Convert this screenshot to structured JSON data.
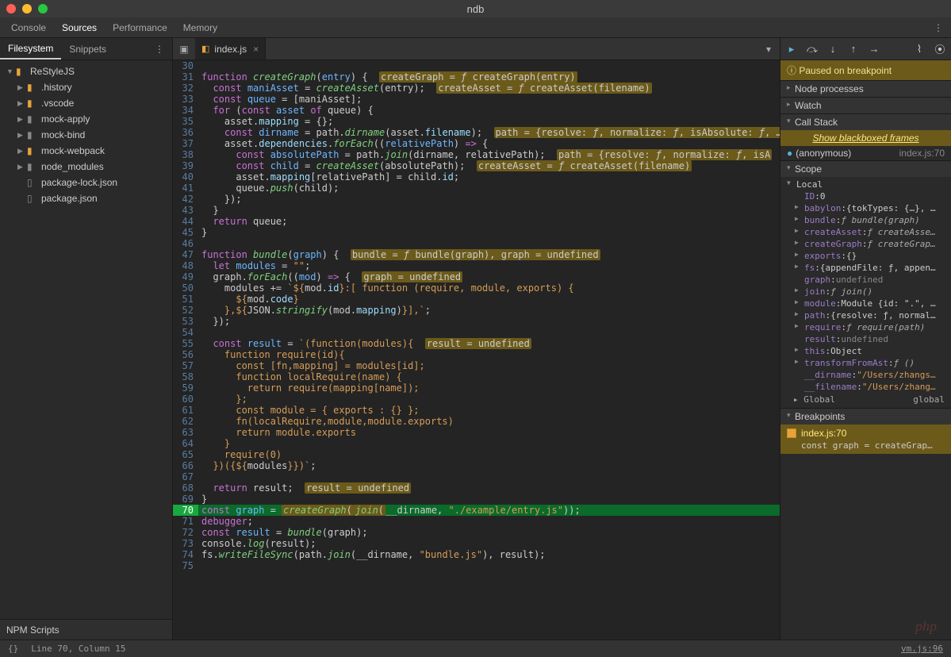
{
  "window": {
    "title": "ndb"
  },
  "top_tabs": [
    "Console",
    "Sources",
    "Performance",
    "Memory"
  ],
  "top_tabs_active": 1,
  "left": {
    "subtabs": [
      "Filesystem",
      "Snippets"
    ],
    "subtabs_active": 0,
    "tree": [
      {
        "level": 1,
        "type": "folder",
        "open": true,
        "color": "orange",
        "label": "ReStyleJS"
      },
      {
        "level": 2,
        "type": "folder",
        "open": false,
        "color": "orange",
        "label": ".history"
      },
      {
        "level": 2,
        "type": "folder",
        "open": false,
        "color": "orange",
        "label": ".vscode"
      },
      {
        "level": 2,
        "type": "folder",
        "open": false,
        "color": "grey",
        "label": "mock-apply"
      },
      {
        "level": 2,
        "type": "folder",
        "open": false,
        "color": "grey",
        "label": "mock-bind"
      },
      {
        "level": 2,
        "type": "folder",
        "open": false,
        "color": "orange",
        "label": "mock-webpack"
      },
      {
        "level": 2,
        "type": "folder",
        "open": false,
        "color": "grey",
        "label": "node_modules"
      },
      {
        "level": 2,
        "type": "file",
        "label": "package-lock.json"
      },
      {
        "level": 2,
        "type": "file",
        "label": "package.json"
      }
    ],
    "npm_scripts_label": "NPM Scripts"
  },
  "editor": {
    "tab_label": "index.js",
    "lines": [
      {
        "n": 30,
        "html": ""
      },
      {
        "n": 31,
        "html": "<span class='kw'>function</span> <span class='fn'>createGraph</span>(<span class='def'>entry</span>) {  <span class='hl'>createGraph = <span class='ital'>ƒ</span> createGraph(entry)</span>"
      },
      {
        "n": 32,
        "html": "  <span class='kw'>const</span> <span class='def'>maniAsset</span> = <span class='fn'>createAsset</span>(entry);  <span class='hl'>createAsset = <span class='ital'>ƒ</span> createAsset(filename)</span>"
      },
      {
        "n": 33,
        "html": "  <span class='kw'>const</span> <span class='def'>queue</span> = [maniAsset];"
      },
      {
        "n": 34,
        "html": "  <span class='kw'>for</span> (<span class='kw'>const</span> <span class='def'>asset</span> <span class='kw'>of</span> queue) {"
      },
      {
        "n": 35,
        "html": "    asset.<span class='prop'>mapping</span> = {};"
      },
      {
        "n": 36,
        "html": "    <span class='kw'>const</span> <span class='def'>dirname</span> = path.<span class='fn'>dirname</span>(asset.<span class='prop'>filename</span>);  <span class='hl'>path = {resolve: <span class='ital'>ƒ</span>, normalize: <span class='ital'>ƒ</span>, isAbsolute: <span class='ital'>ƒ</span>, …</span>"
      },
      {
        "n": 37,
        "html": "    asset.<span class='prop'>dependencies</span>.<span class='fn'>forEach</span>((<span class='def'>relativePath</span>) <span class='kw'>=></span> {"
      },
      {
        "n": 38,
        "html": "      <span class='kw'>const</span> <span class='def'>absolutePath</span> = path.<span class='fn'>join</span>(dirname, relativePath);  <span class='hl'>path = {resolve: <span class='ital'>ƒ</span>, normalize: <span class='ital'>ƒ</span>, isA</span>"
      },
      {
        "n": 39,
        "html": "      <span class='kw'>const</span> <span class='def'>child</span> = <span class='fn'>createAsset</span>(absolutePath);  <span class='hl'>createAsset = <span class='ital'>ƒ</span> createAsset(filename)</span>"
      },
      {
        "n": 40,
        "html": "      asset.<span class='prop'>mapping</span>[relativePath] = child.<span class='prop'>id</span>;"
      },
      {
        "n": 41,
        "html": "      queue.<span class='fn'>push</span>(child);"
      },
      {
        "n": 42,
        "html": "    });"
      },
      {
        "n": 43,
        "html": "  }"
      },
      {
        "n": 44,
        "html": "  <span class='kw'>return</span> queue;"
      },
      {
        "n": 45,
        "html": "}"
      },
      {
        "n": 46,
        "html": ""
      },
      {
        "n": 47,
        "html": "<span class='kw'>function</span> <span class='fn'>bundle</span>(<span class='def'>graph</span>) {  <span class='hl'>bundle = <span class='ital'>ƒ</span> bundle(graph), graph = undefined</span>"
      },
      {
        "n": 48,
        "html": "  <span class='kw'>let</span> <span class='def'>modules</span> = <span class='str'>\"\"</span>;"
      },
      {
        "n": 49,
        "html": "  graph.<span class='fn'>forEach</span>((<span class='def'>mod</span>) <span class='kw'>=></span> {  <span class='hl'>graph = undefined</span>"
      },
      {
        "n": 50,
        "html": "    modules += <span class='str'>`${</span>mod.<span class='prop'>id</span><span class='str'>}:[ function (require, module, exports) {</span>"
      },
      {
        "n": 51,
        "html": "<span class='str'>      ${</span>mod.<span class='prop'>code</span><span class='str'>}</span>"
      },
      {
        "n": 52,
        "html": "<span class='str'>    },${</span>JSON.<span class='fn'>stringify</span>(mod.<span class='prop'>mapping</span>)<span class='str'>}],`</span>;"
      },
      {
        "n": 53,
        "html": "  });"
      },
      {
        "n": 54,
        "html": ""
      },
      {
        "n": 55,
        "html": "  <span class='kw'>const</span> <span class='def'>result</span> = <span class='str'>`(function(modules){</span>  <span class='hl'>result = undefined</span>"
      },
      {
        "n": 56,
        "html": "<span class='str'>    function require(id){</span>"
      },
      {
        "n": 57,
        "html": "<span class='str'>      const [fn,mapping] = modules[id];</span>"
      },
      {
        "n": 58,
        "html": "<span class='str'>      function localRequire(name) {</span>"
      },
      {
        "n": 59,
        "html": "<span class='str'>        return require(mapping[name]);</span>"
      },
      {
        "n": 60,
        "html": "<span class='str'>      };</span>"
      },
      {
        "n": 61,
        "html": "<span class='str'>      const module = { exports : {} };</span>"
      },
      {
        "n": 62,
        "html": "<span class='str'>      fn(localRequire,module,module.exports)</span>"
      },
      {
        "n": 63,
        "html": "<span class='str'>      return module.exports</span>"
      },
      {
        "n": 64,
        "html": "<span class='str'>    }</span>"
      },
      {
        "n": 65,
        "html": "<span class='str'>    require(0)</span>"
      },
      {
        "n": 66,
        "html": "<span class='str'>  })({${</span>modules<span class='str'>}})`</span>;"
      },
      {
        "n": 67,
        "html": ""
      },
      {
        "n": 68,
        "html": "  <span class='kw'>return</span> result;  <span class='hl'>result = undefined</span>"
      },
      {
        "n": 69,
        "html": "}"
      },
      {
        "n": 70,
        "exec": true,
        "html": "<span class='kw'>const</span> <span class='def'>graph</span> = <span class='hl'><span class='fn'>createGraph</span>(</span><span class='hl'><span class='fn'>join</span>(</span>__dirname, <span class='str'>\"./example/entry.js\"</span>));"
      },
      {
        "n": 71,
        "html": "<span class='kw'>debugger</span>;"
      },
      {
        "n": 72,
        "html": "<span class='kw'>const</span> <span class='def'>result</span> = <span class='fn'>bundle</span>(graph);"
      },
      {
        "n": 73,
        "html": "console.<span class='fn'>log</span>(result);"
      },
      {
        "n": 74,
        "html": "fs.<span class='fn'>writeFileSync</span>(path.<span class='fn'>join</span>(__dirname, <span class='str'>\"bundle.js\"</span>), result);"
      },
      {
        "n": 75,
        "html": ""
      }
    ]
  },
  "debugger": {
    "paused_msg": "Paused on breakpoint",
    "sections": {
      "node_processes": "Node processes",
      "watch": "Watch",
      "call_stack": "Call Stack",
      "scope": "Scope",
      "breakpoints": "Breakpoints"
    },
    "blackboxed_label": "Show blackboxed frames",
    "call_stack": [
      {
        "name": "(anonymous)",
        "loc": "index.js:70"
      }
    ],
    "scope": {
      "local_label": "Local",
      "global_label": "Global",
      "global_value": "global",
      "local": [
        {
          "k": "ID",
          "v": "0",
          "t": "num",
          "expand": false
        },
        {
          "k": "babylon",
          "v": "{tokTypes: {…}, …",
          "t": "obj",
          "expand": true
        },
        {
          "k": "bundle",
          "v": "ƒ bundle(graph)",
          "t": "fn",
          "expand": true
        },
        {
          "k": "createAsset",
          "v": "ƒ createAsse…",
          "t": "fn",
          "expand": true
        },
        {
          "k": "createGraph",
          "v": "ƒ createGrap…",
          "t": "fn",
          "expand": true
        },
        {
          "k": "exports",
          "v": "{}",
          "t": "obj",
          "expand": true
        },
        {
          "k": "fs",
          "v": "{appendFile: ƒ, appen…",
          "t": "obj",
          "expand": true
        },
        {
          "k": "graph",
          "v": "undefined",
          "t": "und",
          "expand": false
        },
        {
          "k": "join",
          "v": "ƒ join()",
          "t": "fn",
          "expand": true
        },
        {
          "k": "module",
          "v": "Module {id: \".\", …",
          "t": "obj",
          "expand": true
        },
        {
          "k": "path",
          "v": "{resolve: ƒ, normal…",
          "t": "obj",
          "expand": true
        },
        {
          "k": "require",
          "v": "ƒ require(path)",
          "t": "fn",
          "expand": true
        },
        {
          "k": "result",
          "v": "undefined",
          "t": "und",
          "expand": false
        },
        {
          "k": "this",
          "v": "Object",
          "t": "obj",
          "expand": true
        },
        {
          "k": "transformFromAst",
          "v": "ƒ ()",
          "t": "fn",
          "expand": true
        },
        {
          "k": "__dirname",
          "v": "\"/Users/zhangs…",
          "t": "str",
          "expand": false
        },
        {
          "k": "__filename",
          "v": "\"/Users/zhang…",
          "t": "str",
          "expand": false
        }
      ]
    },
    "breakpoints": [
      {
        "file": "index.js:70",
        "code": "const graph = createGrap…"
      }
    ]
  },
  "status": {
    "cursor": "Line 70, Column 15",
    "source": "vm.js:96"
  },
  "watermark": "php"
}
